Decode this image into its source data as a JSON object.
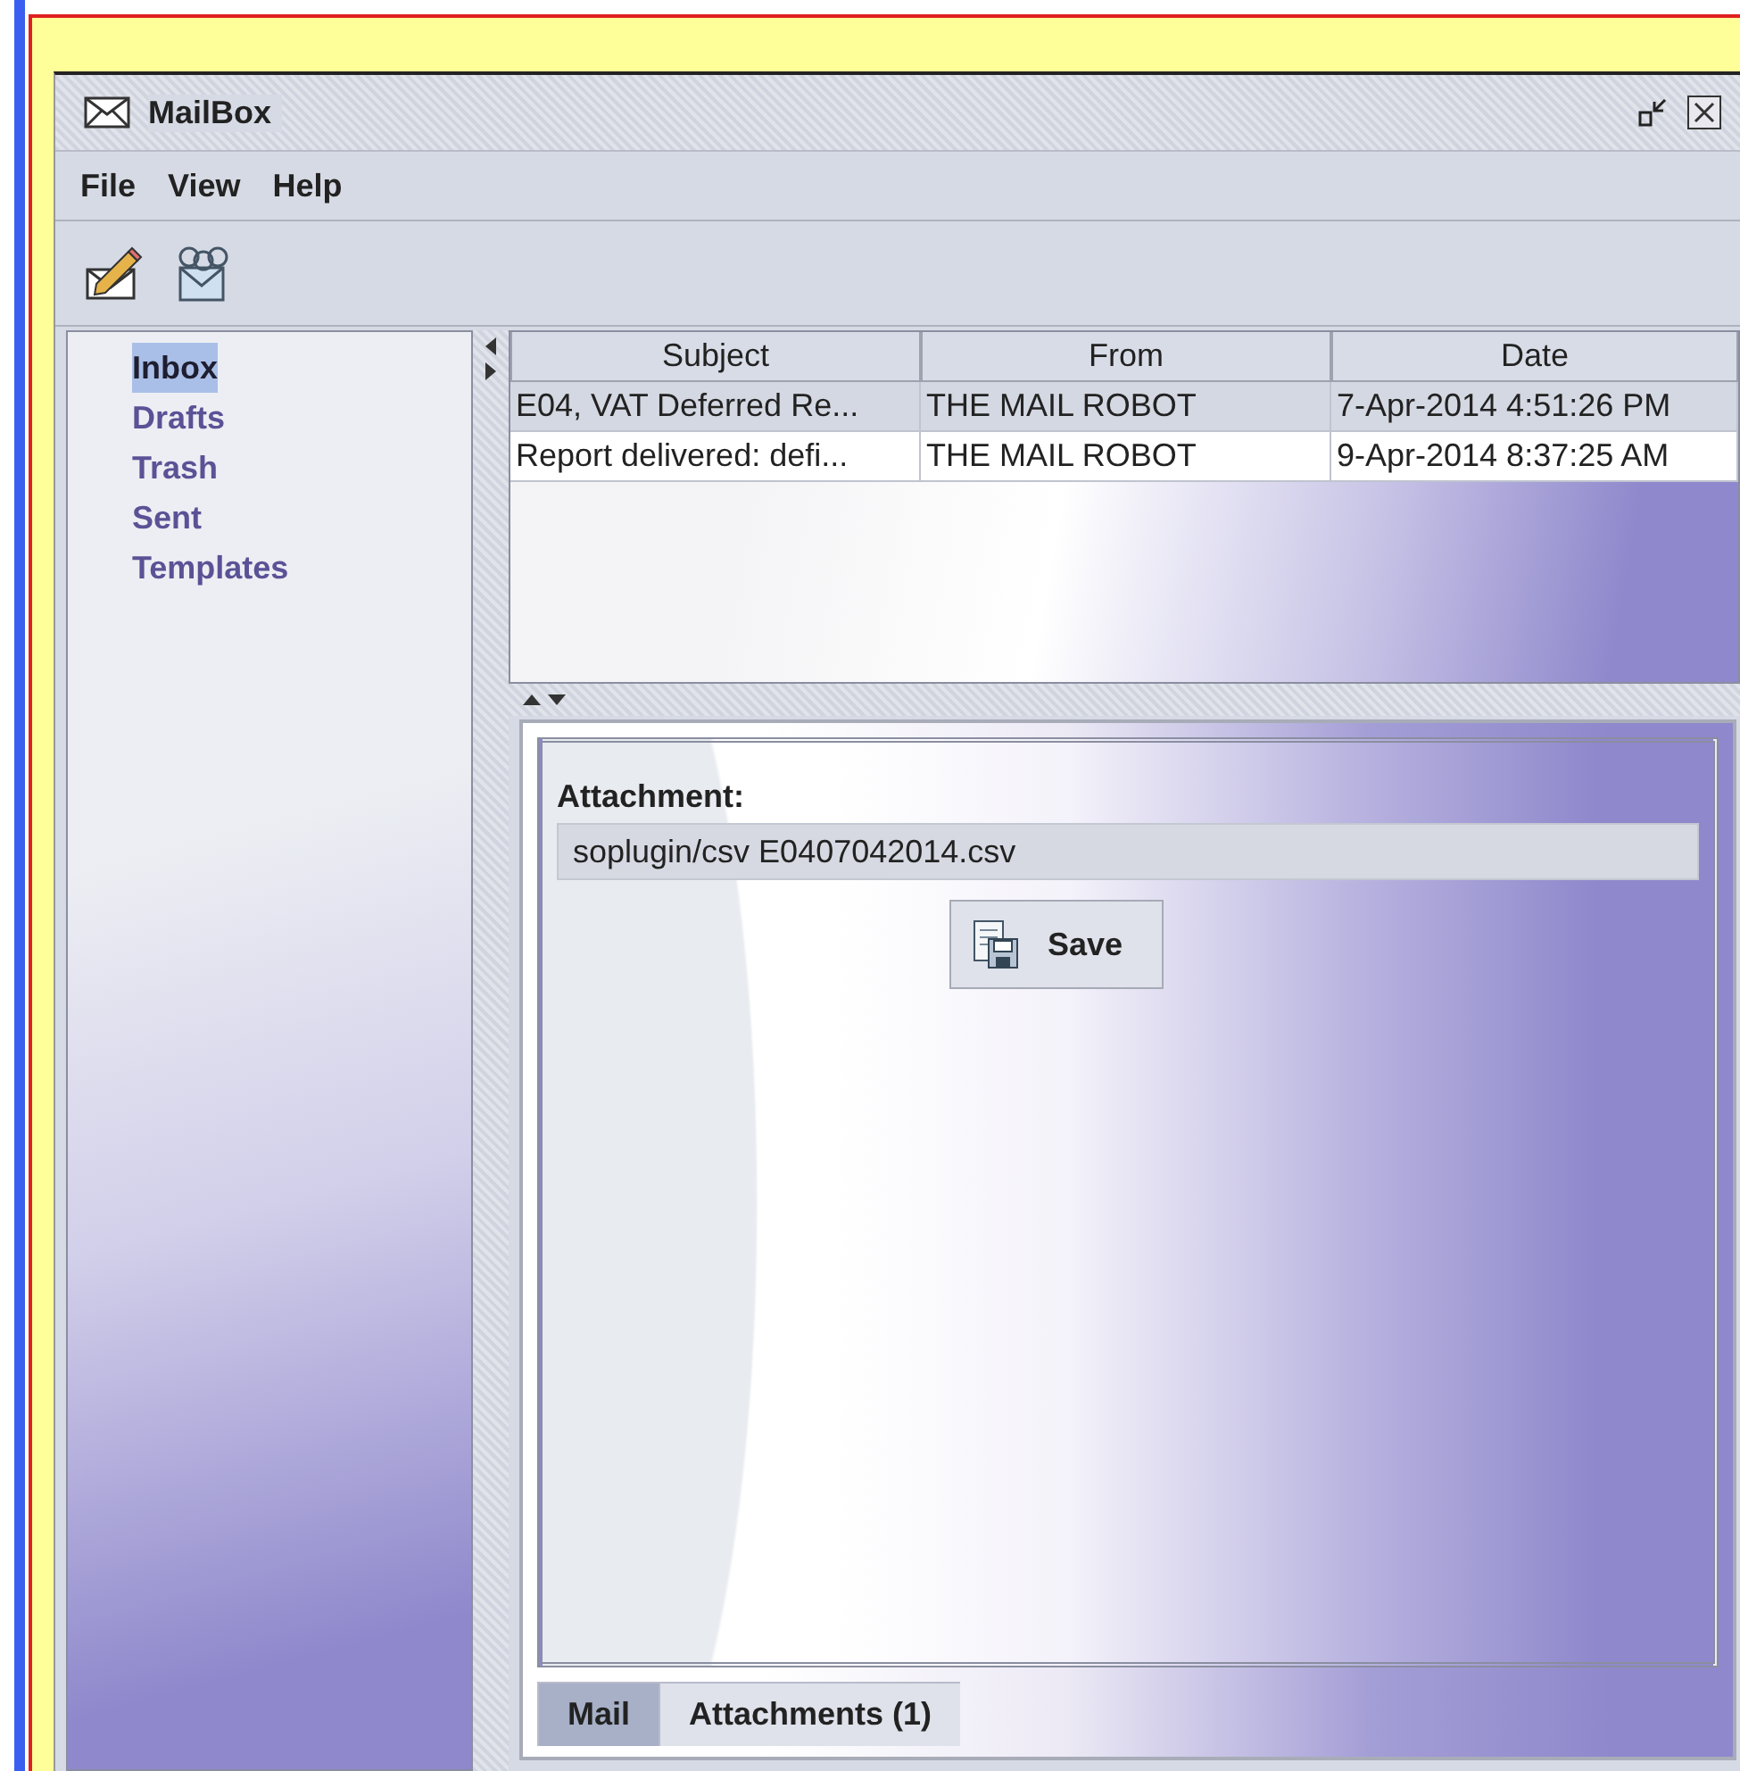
{
  "window": {
    "title": "MailBox"
  },
  "menu": [
    "File",
    "View",
    "Help"
  ],
  "folders": [
    {
      "label": "Inbox",
      "selected": true
    },
    {
      "label": "Drafts",
      "selected": false
    },
    {
      "label": "Trash",
      "selected": false
    },
    {
      "label": "Sent",
      "selected": false
    },
    {
      "label": "Templates",
      "selected": false
    }
  ],
  "table": {
    "columns": [
      "Subject",
      "From",
      "Date"
    ],
    "rows": [
      {
        "cells": [
          "E04, VAT Deferred Re...",
          "THE MAIL ROBOT",
          "7-Apr-2014 4:51:26 PM"
        ],
        "selected": true
      },
      {
        "cells": [
          "Report delivered: defi...",
          "THE MAIL ROBOT",
          "9-Apr-2014 8:37:25 AM"
        ],
        "selected": false
      }
    ]
  },
  "attachments": {
    "label": "Attachment:",
    "items": [
      {
        "text": "soplugin/csv E0407042014.csv",
        "selected": true
      }
    ]
  },
  "popup_menu": {
    "items": [
      "Save"
    ]
  },
  "tabs": [
    {
      "label": "Mail",
      "selected": false
    },
    {
      "label": "Attachments (1)",
      "selected": true
    }
  ]
}
